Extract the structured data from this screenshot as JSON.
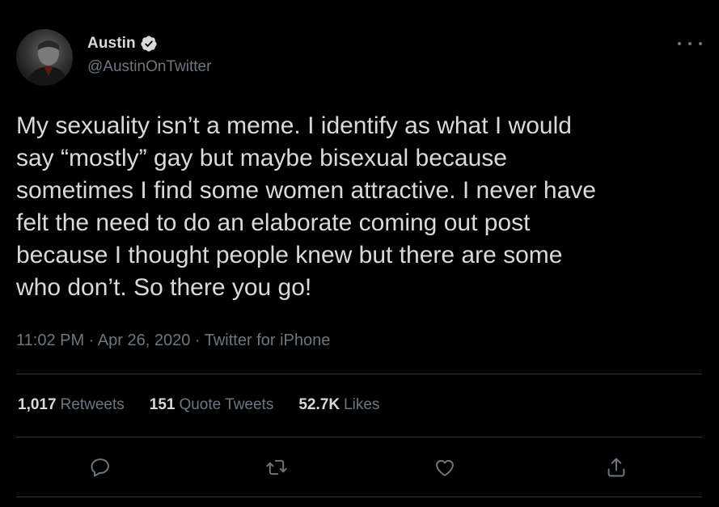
{
  "user": {
    "display_name": "Austin",
    "handle": "@AustinOnTwitter",
    "verified_icon": "verified-badge-icon"
  },
  "tweet": {
    "text": "My sexuality isn’t a meme. I identify as what I would\nsay “mostly” gay but maybe bisexual because\nsometimes I find some women attractive. I never have\nfelt the need to do an elaborate coming out post\nbecause I thought people knew but there are some\nwho don’t. So there you go!",
    "meta": "11:02 PM · Apr 26, 2020 · Twitter for iPhone"
  },
  "stats": {
    "retweets_count": "1,017",
    "retweets_label": "Retweets",
    "quotes_count": "151",
    "quotes_label": "Quote Tweets",
    "likes_count": "52.7K",
    "likes_label": "Likes"
  },
  "actions": {
    "reply_icon": "reply-icon",
    "retweet_icon": "retweet-icon",
    "like_icon": "heart-icon",
    "share_icon": "share-icon"
  },
  "colors": {
    "background": "#000000",
    "text": "#d9d9d9",
    "secondary_text": "#6e767d",
    "divider": "#2f3336"
  }
}
